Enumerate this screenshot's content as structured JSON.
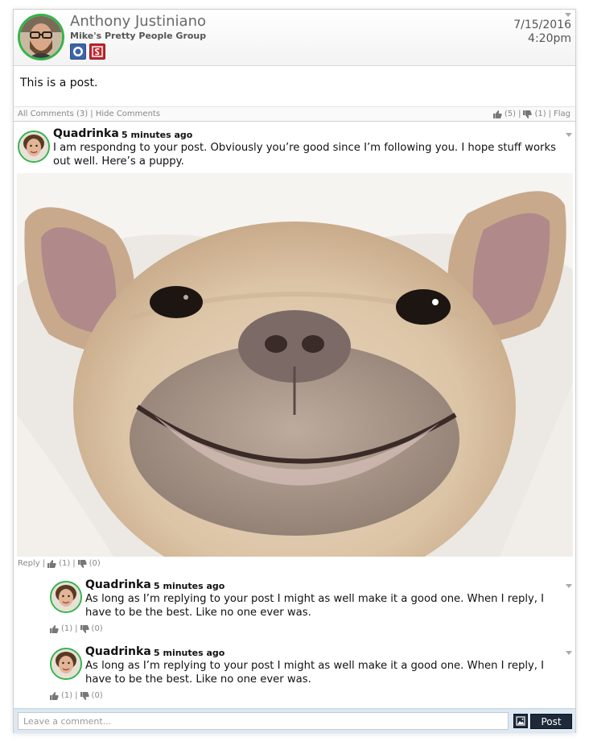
{
  "post": {
    "author": "Anthony Justiniano",
    "group": "Mike's Pretty People Group",
    "date": "7/15/2016",
    "time": "4:20pm",
    "body": "This is a post.",
    "meta_left": "All Comments (3) | Hide Comments",
    "likes": "(5)",
    "dislikes": "(1)",
    "separator": "|",
    "flag": "Flag"
  },
  "comment": {
    "name": "Quadrinka",
    "time": "5 minutes ago",
    "text": "I am respondng to your post. Obviously you’re good since I’m following you. I hope stuff works out well. Here’s a puppy.",
    "reply_label": "Reply",
    "likes": "(1)",
    "dislikes": "(0)"
  },
  "replies": [
    {
      "name": "Quadrinka",
      "time": "5 minutes ago",
      "text": "As long as I’m replying to your post I might as well make it a good one. When I reply, I have to be the best. Like no one ever was.",
      "likes": "(1)",
      "dislikes": "(0)"
    },
    {
      "name": "Quadrinka",
      "time": "5 minutes ago",
      "text": "As long as I’m replying to your post I might as well make it a good one. When I reply, I have to be the best. Like no one ever was.",
      "likes": "(1)",
      "dislikes": "(0)"
    }
  ],
  "composer": {
    "placeholder": "Leave a comment...",
    "post_label": "Post"
  },
  "colors": {
    "avatar_ring": "#35b34a",
    "button_bg": "#1e2a3a",
    "composer_bg": "#dce8f2"
  }
}
